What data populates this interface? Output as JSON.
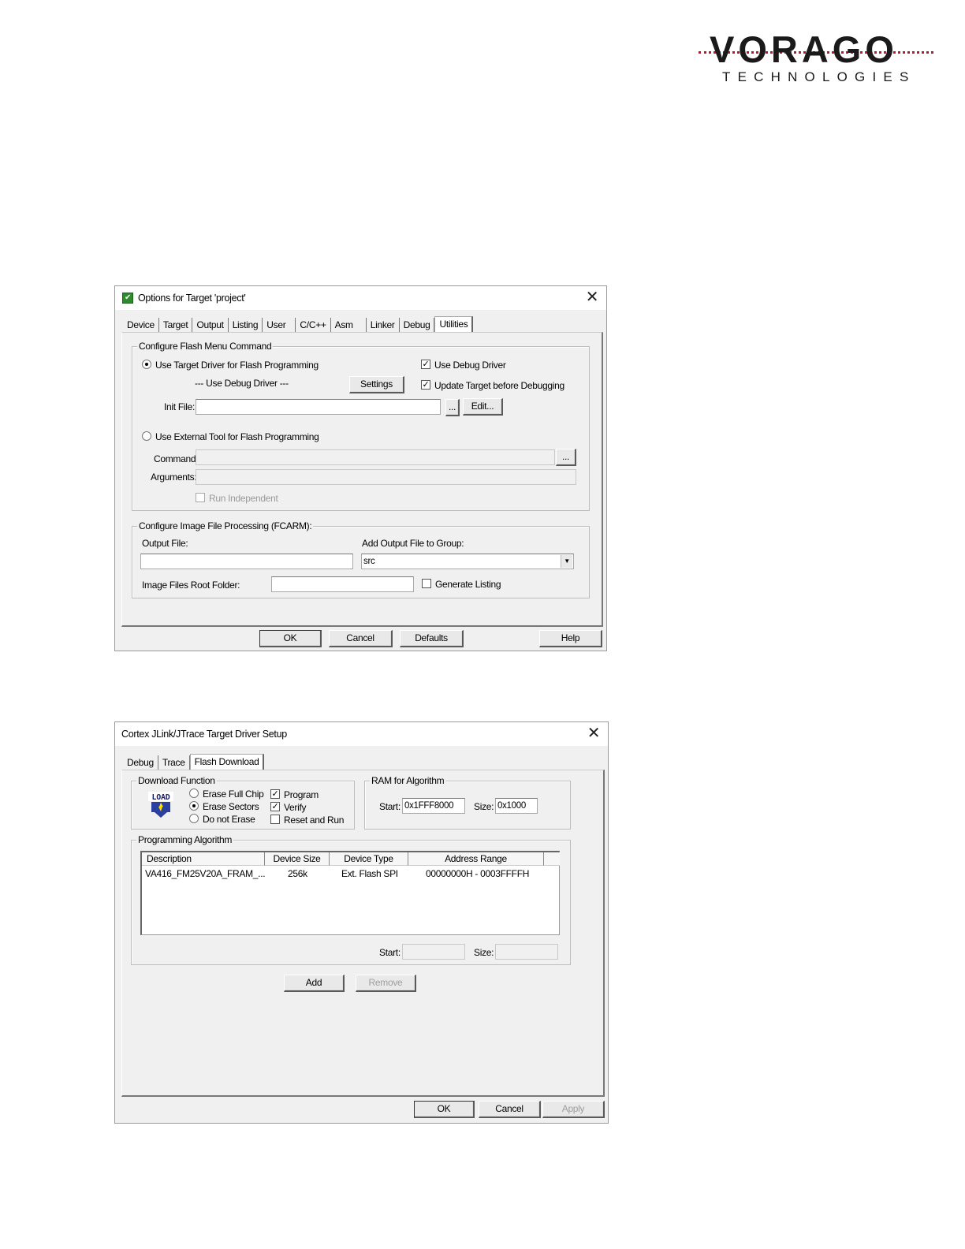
{
  "logo": {
    "word": "VORAGO",
    "sub": "TECHNOLOGIES"
  },
  "dialog1": {
    "title": "Options for Target 'project'",
    "tabs": [
      "Device",
      "Target",
      "Output",
      "Listing",
      "User",
      "C/C++",
      "Asm",
      "Linker",
      "Debug",
      "Utilities"
    ],
    "active_tab": "Utilities",
    "flash_group": {
      "title": "Configure Flash Menu Command",
      "use_target_driver": "Use Target Driver for Flash Programming",
      "use_target_driver_checked": true,
      "driver_select": "--- Use Debug Driver ---",
      "settings_btn": "Settings",
      "use_debug_driver": "Use Debug Driver",
      "use_debug_driver_checked": true,
      "update_target": "Update Target before Debugging",
      "update_target_checked": true,
      "init_file_label": "Init File:",
      "init_file_value": "",
      "browse_btn": "...",
      "edit_btn": "Edit...",
      "use_external_tool": "Use External Tool for Flash Programming",
      "use_external_tool_checked": false,
      "command_label": "Command:",
      "command_value": "",
      "command_browse": "...",
      "arguments_label": "Arguments:",
      "arguments_value": "",
      "run_independent": "Run Independent",
      "run_independent_checked": false
    },
    "image_group": {
      "title": "Configure Image File Processing (FCARM):",
      "output_file_label": "Output File:",
      "output_file_value": "",
      "add_output_label": "Add Output File  to Group:",
      "group_value": "src",
      "root_folder_label": "Image Files Root Folder:",
      "root_folder_value": "",
      "generate_listing": "Generate Listing",
      "generate_listing_checked": false
    },
    "buttons": {
      "ok": "OK",
      "cancel": "Cancel",
      "defaults": "Defaults",
      "help": "Help"
    }
  },
  "dialog2": {
    "title": "Cortex JLink/JTrace Target Driver Setup",
    "tabs": [
      "Debug",
      "Trace",
      "Flash Download"
    ],
    "active_tab": "Flash Download",
    "download_function": {
      "title": "Download Function",
      "icon_text": "LOAD",
      "erase_full_chip": "Erase Full Chip",
      "erase_sectors": "Erase Sectors",
      "do_not_erase": "Do not Erase",
      "selected_erase": "erase_sectors",
      "program": "Program",
      "program_checked": true,
      "verify": "Verify",
      "verify_checked": true,
      "reset_and_run": "Reset and Run",
      "reset_and_run_checked": false
    },
    "ram": {
      "title": "RAM for Algorithm",
      "start_label": "Start:",
      "start_value": "0x1FFF8000",
      "size_label": "Size:",
      "size_value": "0x1000"
    },
    "algorithm": {
      "title": "Programming Algorithm",
      "columns": [
        "Description",
        "Device Size",
        "Device Type",
        "Address Range"
      ],
      "rows": [
        {
          "description": "VA416_FM25V20A_FRAM_...",
          "device_size": "256k",
          "device_type": "Ext. Flash SPI",
          "address_range": "00000000H - 0003FFFFH"
        }
      ],
      "start_label": "Start:",
      "start_value": "",
      "size_label": "Size:",
      "size_value": ""
    },
    "add_btn": "Add",
    "remove_btn": "Remove",
    "buttons": {
      "ok": "OK",
      "cancel": "Cancel",
      "apply": "Apply"
    }
  }
}
